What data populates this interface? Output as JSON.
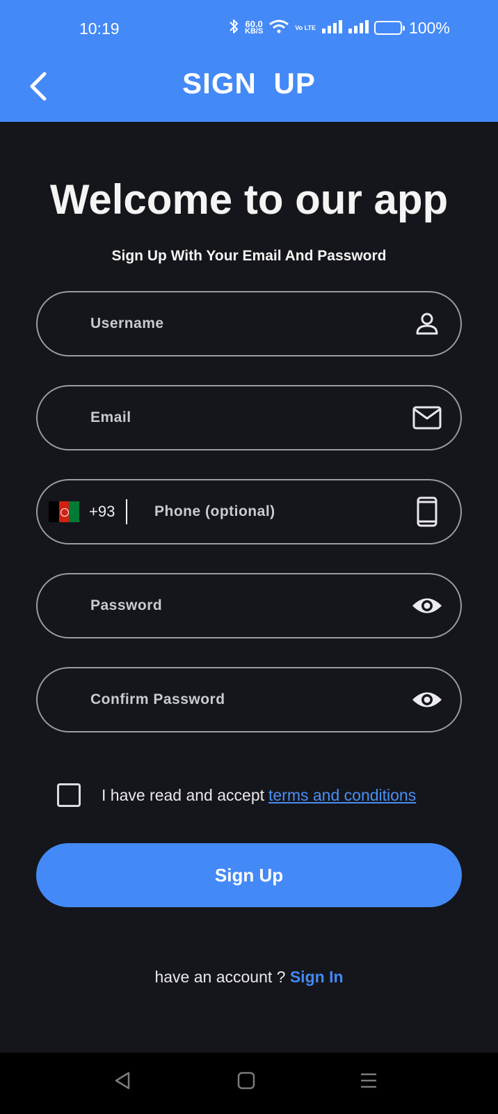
{
  "status_bar": {
    "time": "10:19",
    "net_speed_value": "60.0",
    "net_speed_unit": "KB/S",
    "volte": "Vo LTE",
    "battery_percent": "100%",
    "battery_level": 1.0
  },
  "app_bar": {
    "title": "SIGN  UP",
    "back_icon": "chevron-left-icon"
  },
  "main": {
    "heading": "Welcome to our app",
    "subtitle": "Sign Up With Your Email And Password"
  },
  "form": {
    "username": {
      "placeholder": "Username",
      "value": "",
      "icon": "person-icon"
    },
    "email": {
      "placeholder": "Email",
      "value": "",
      "icon": "mail-icon"
    },
    "phone": {
      "country_flag": "afghanistan-flag",
      "dial_code": "+93",
      "placeholder": "Phone (optional)",
      "value": "",
      "icon": "smartphone-icon"
    },
    "password": {
      "placeholder": "Password",
      "value": "",
      "icon": "eye-icon"
    },
    "confirm_password": {
      "placeholder": "Confirm Password",
      "value": "",
      "icon": "eye-icon"
    }
  },
  "terms": {
    "checked": false,
    "text": "I have read and accept",
    "link": "terms and conditions"
  },
  "signup_button": {
    "label": "Sign Up"
  },
  "signin_row": {
    "text": "have an account ?",
    "link": "Sign In"
  },
  "colors": {
    "accent": "#4489f8",
    "background": "#15161b",
    "link": "#4a8ff6",
    "field_border": "#9a9ca3"
  }
}
